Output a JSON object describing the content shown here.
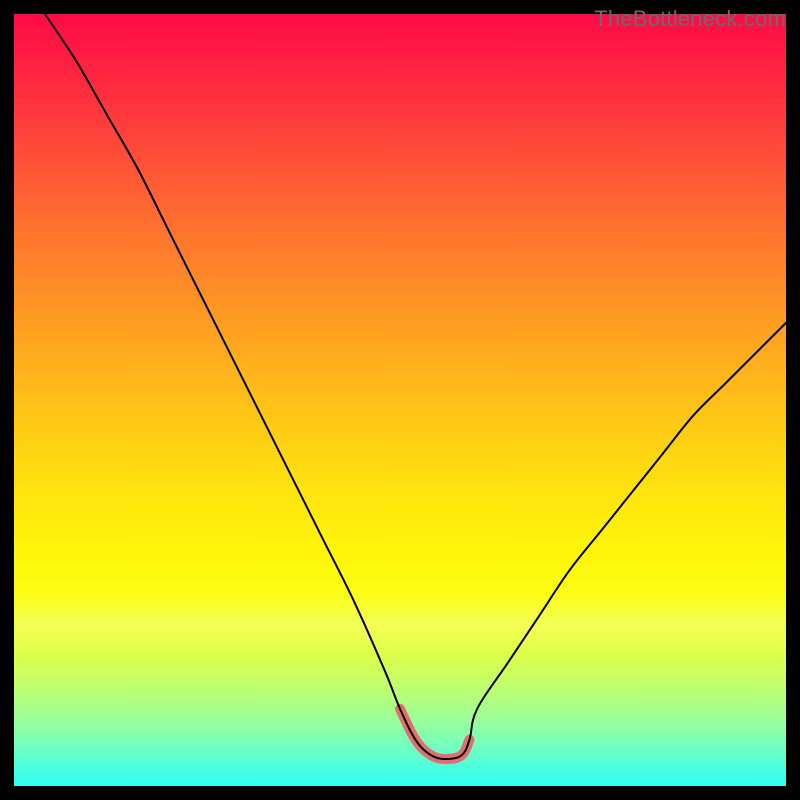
{
  "watermark": "TheBottleneck.com",
  "chart_data": {
    "type": "line",
    "title": "",
    "xlabel": "",
    "ylabel": "",
    "xlim": [
      0,
      100
    ],
    "ylim": [
      0,
      100
    ],
    "axes_visible": false,
    "grid": false,
    "background": "rainbow-vertical",
    "series": [
      {
        "name": "bottleneck-curve",
        "color": "#000000",
        "stroke_width": 2,
        "x": [
          4,
          8,
          12,
          16,
          20,
          24,
          28,
          32,
          36,
          40,
          44,
          48,
          50,
          52,
          54,
          56,
          58,
          59,
          60,
          64,
          68,
          72,
          76,
          80,
          84,
          88,
          92,
          96,
          100
        ],
        "y": [
          100,
          94,
          87,
          80,
          72,
          64,
          56,
          48,
          40,
          32,
          24,
          15,
          10,
          6,
          4,
          3.5,
          4,
          6,
          10,
          16,
          22,
          28,
          33,
          38,
          43,
          48,
          52,
          56,
          60
        ]
      },
      {
        "name": "flat-bottom-highlight",
        "color": "#e07070",
        "stroke_width": 10,
        "x": [
          50,
          52,
          54,
          56,
          58,
          59
        ],
        "y": [
          10,
          6,
          4,
          3.5,
          4,
          6
        ]
      }
    ],
    "annotations": []
  },
  "colors": {
    "page_bg": "#000000",
    "curve": "#000000",
    "highlight": "#e07070",
    "watermark": "#6b6b6b"
  }
}
